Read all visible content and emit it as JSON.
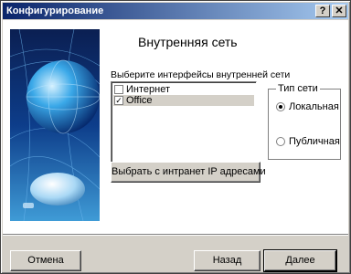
{
  "window": {
    "title": "Конфигурирование",
    "help_label": "?",
    "close_label": "✕"
  },
  "page": {
    "heading": "Внутренняя сеть"
  },
  "interfaces": {
    "label": "Выберите интерфейсы внутренней сети",
    "items": [
      {
        "label": "Интернет",
        "checked": false,
        "mark": ""
      },
      {
        "label": "Office",
        "checked": true,
        "mark": "✓"
      }
    ]
  },
  "network_type": {
    "label": "Тип сети",
    "options": [
      {
        "label": "Локальная",
        "selected": true
      },
      {
        "label": "Публичная",
        "selected": false
      }
    ]
  },
  "buttons": {
    "select_ip": "Выбрать с интранет IP адресами",
    "cancel": "Отмена",
    "back": "Назад",
    "next": "Далее"
  }
}
